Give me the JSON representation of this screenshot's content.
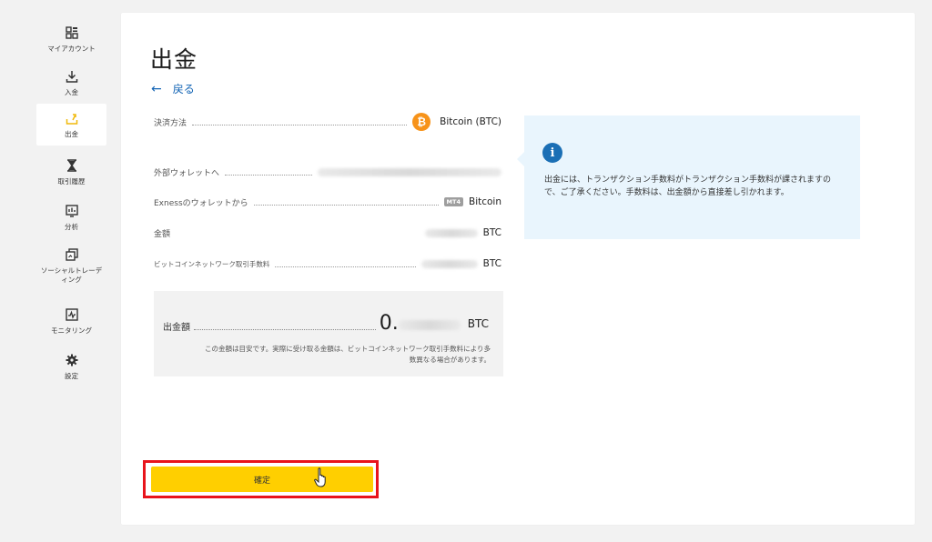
{
  "sidebar": {
    "items": [
      {
        "label": "マイアカウント",
        "icon": "grid-icon",
        "active": false
      },
      {
        "label": "入金",
        "icon": "download-icon",
        "active": false
      },
      {
        "label": "出金",
        "icon": "upload-icon",
        "active": true
      },
      {
        "label": "取引履歴",
        "icon": "hourglass-icon",
        "active": false
      },
      {
        "label": "分析",
        "icon": "chart-icon",
        "active": false
      },
      {
        "label": "ソーシャルトレーディング",
        "icon": "copy-icon",
        "active": false
      },
      {
        "label": "モニタリング",
        "icon": "monitor-icon",
        "active": false
      },
      {
        "label": "設定",
        "icon": "gear-icon",
        "active": false
      }
    ],
    "accent": "#f0b90b"
  },
  "page": {
    "title": "出金",
    "back_label": "戻る"
  },
  "details": {
    "payment_method_label": "決済方法",
    "payment_method_value": "Bitcoin (BTC)",
    "to_wallet_label": "外部ウォレットへ",
    "from_wallet_label": "Exnessのウォレットから",
    "from_wallet_tag": "MT4",
    "from_wallet_value": "Bitcoin",
    "amount_label": "金額",
    "amount_unit": "BTC",
    "fee_label": "ビットコインネットワーク取引手数料",
    "fee_unit": "BTC"
  },
  "summary": {
    "label": "出金額",
    "amount_prefix": "0.",
    "unit": "BTC",
    "note": "この金額は目安です。実際に受け取る金額は、ビットコインネットワーク取引手数料により多数異なる場合があります。"
  },
  "info": {
    "text": "出金には、トランザクション手数料がトランザクション手数料が課されますので、ご了承ください。手数料は、出金額から直接差し引かれます。"
  },
  "actions": {
    "confirm_label": "確定"
  },
  "colors": {
    "confirm_button": "#ffcf00",
    "highlight": "#e8141c",
    "link": "#1465b5",
    "info_bg": "#e9f5fd",
    "bitcoin": "#f7931a"
  }
}
